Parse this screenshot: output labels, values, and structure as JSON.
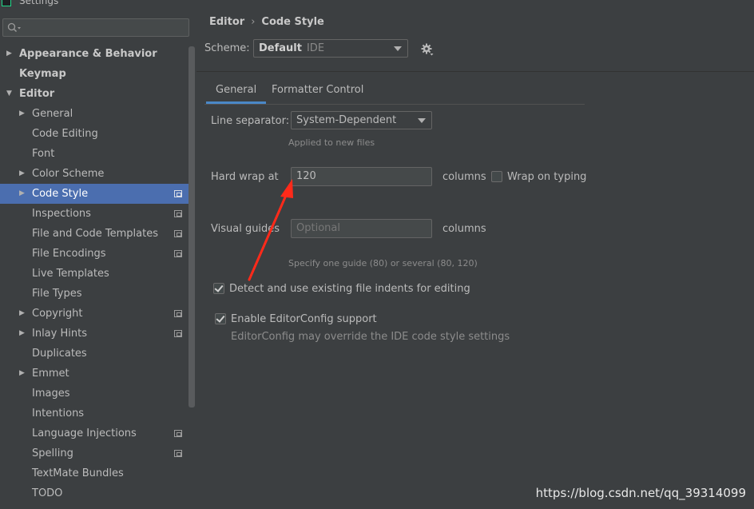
{
  "window": {
    "title": "Settings"
  },
  "search": {
    "placeholder": "Q▾"
  },
  "tree": [
    {
      "label": "Appearance & Behavior",
      "level": 0,
      "arrow": "right",
      "bold": true
    },
    {
      "label": "Keymap",
      "level": 0,
      "arrow": "",
      "bold": true
    },
    {
      "label": "Editor",
      "level": 0,
      "arrow": "down",
      "bold": true
    },
    {
      "label": "General",
      "level": 1,
      "arrow": "right"
    },
    {
      "label": "Code Editing",
      "level": 1,
      "arrow": ""
    },
    {
      "label": "Font",
      "level": 1,
      "arrow": ""
    },
    {
      "label": "Color Scheme",
      "level": 1,
      "arrow": "right"
    },
    {
      "label": "Code Style",
      "level": 1,
      "arrow": "right",
      "selected": true,
      "copy": true
    },
    {
      "label": "Inspections",
      "level": 1,
      "arrow": "",
      "copy": true
    },
    {
      "label": "File and Code Templates",
      "level": 1,
      "arrow": "",
      "copy": true
    },
    {
      "label": "File Encodings",
      "level": 1,
      "arrow": "",
      "copy": true
    },
    {
      "label": "Live Templates",
      "level": 1,
      "arrow": ""
    },
    {
      "label": "File Types",
      "level": 1,
      "arrow": ""
    },
    {
      "label": "Copyright",
      "level": 1,
      "arrow": "right",
      "copy": true
    },
    {
      "label": "Inlay Hints",
      "level": 1,
      "arrow": "right",
      "copy": true
    },
    {
      "label": "Duplicates",
      "level": 1,
      "arrow": ""
    },
    {
      "label": "Emmet",
      "level": 1,
      "arrow": "right"
    },
    {
      "label": "Images",
      "level": 1,
      "arrow": ""
    },
    {
      "label": "Intentions",
      "level": 1,
      "arrow": ""
    },
    {
      "label": "Language Injections",
      "level": 1,
      "arrow": "",
      "copy": true
    },
    {
      "label": "Spelling",
      "level": 1,
      "arrow": "",
      "copy": true
    },
    {
      "label": "TextMate Bundles",
      "level": 1,
      "arrow": ""
    },
    {
      "label": "TODO",
      "level": 1,
      "arrow": ""
    }
  ],
  "breadcrumb": {
    "parent": "Editor",
    "separator": "›",
    "current": "Code Style"
  },
  "scheme": {
    "label": "Scheme:",
    "name": "Default",
    "type": "IDE"
  },
  "tabs": [
    {
      "label": "General",
      "active": true
    },
    {
      "label": "Formatter Control"
    }
  ],
  "general": {
    "line_separator_label": "Line separator:",
    "line_separator_value": "System-Dependent",
    "line_separator_hint": "Applied to new files",
    "hard_wrap_label": "Hard wrap at",
    "hard_wrap_value": "120",
    "hard_wrap_unit": "columns",
    "wrap_on_typing_label": "Wrap on typing",
    "wrap_on_typing_checked": false,
    "visual_guides_label": "Visual guides",
    "visual_guides_placeholder": "Optional",
    "visual_guides_unit": "columns",
    "visual_guides_hint": "Specify one guide (80) or several (80, 120)",
    "detect_indents_label": "Detect and use existing file indents for editing",
    "detect_indents_checked": true,
    "editorconfig_label": "Enable EditorConfig support",
    "editorconfig_checked": true,
    "editorconfig_hint": "EditorConfig may override the IDE code style settings"
  },
  "annotation": {
    "color": "#ff2a1a"
  },
  "watermark": "https://blog.csdn.net/qq_39314099"
}
